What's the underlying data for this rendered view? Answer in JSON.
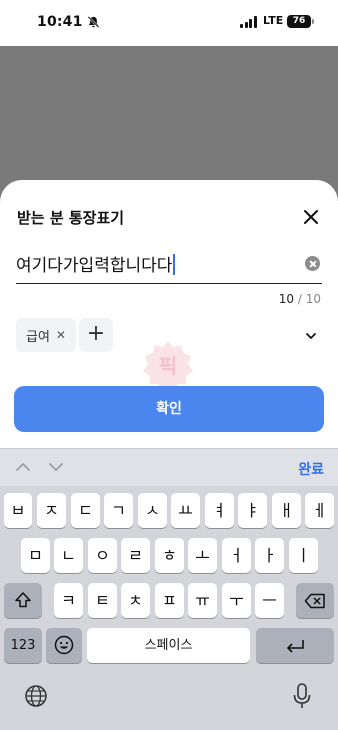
{
  "status_bar": {
    "time": "10:41",
    "network": "LTE",
    "battery": "76"
  },
  "sheet": {
    "title": "받는 분 통장표기",
    "input_value": "여기다가입력합니다다",
    "counter_current": "10",
    "counter_max": " / 10",
    "chip_label": "급여",
    "chip_remove": "✕",
    "add_label": "+",
    "confirm_label": "확인",
    "watermark_text": "픽"
  },
  "keyboard": {
    "done_label": "완료",
    "row1": [
      "ㅂ",
      "ㅈ",
      "ㄷ",
      "ㄱ",
      "ㅅ",
      "ㅛ",
      "ㅕ",
      "ㅑ",
      "ㅐ",
      "ㅔ"
    ],
    "row2": [
      "ㅁ",
      "ㄴ",
      "ㅇ",
      "ㄹ",
      "ㅎ",
      "ㅗ",
      "ㅓ",
      "ㅏ",
      "ㅣ"
    ],
    "row3": [
      "ㅋ",
      "ㅌ",
      "ㅊ",
      "ㅍ",
      "ㅠ",
      "ㅜ",
      "ㅡ"
    ],
    "numbers_label": "123",
    "space_label": "스페이스"
  },
  "colors": {
    "accent": "#4a86ee",
    "keyboard_bg": "#d3d5db",
    "backdrop": "#7a7a7a"
  }
}
